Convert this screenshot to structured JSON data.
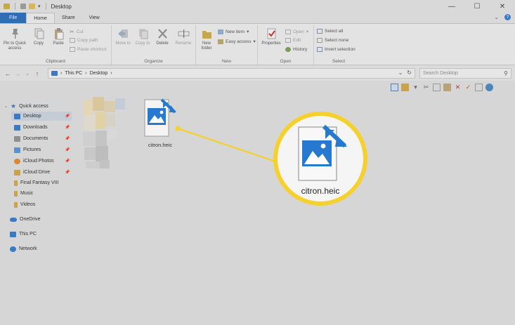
{
  "window": {
    "title": "Desktop"
  },
  "colors": {
    "accent": "#2f6db5",
    "callout": "#f6d02c",
    "heic_blue": "#2779d0"
  },
  "ribbon_tabs": [
    "File",
    "Home",
    "Share",
    "View"
  ],
  "ribbon": {
    "clipboard": {
      "label": "Clipboard",
      "pin": "Pin to Quick access",
      "copy": "Copy",
      "paste": "Paste",
      "cut": "Cut",
      "copy_path": "Copy path",
      "paste_shortcut": "Paste shortcut"
    },
    "organize": {
      "label": "Organize",
      "move_to": "Move to",
      "copy_to": "Copy to",
      "delete": "Delete",
      "rename": "Rename"
    },
    "new": {
      "label": "New",
      "new_folder": "New folder",
      "new_item": "New item",
      "easy_access": "Easy access"
    },
    "open": {
      "label": "Open",
      "properties": "Properties",
      "open": "Open",
      "edit": "Edit",
      "history": "History"
    },
    "select": {
      "label": "Select",
      "select_all": "Select all",
      "select_none": "Select none",
      "invert": "Invert selection"
    }
  },
  "address": {
    "crumbs": [
      "This PC",
      "Desktop"
    ],
    "search_placeholder": "Search Desktop"
  },
  "nav_pane": {
    "quick_access": "Quick access",
    "items": [
      {
        "label": "Desktop",
        "pinned": true,
        "selected": true
      },
      {
        "label": "Downloads",
        "pinned": true
      },
      {
        "label": "Documents",
        "pinned": true
      },
      {
        "label": "Pictures",
        "pinned": true
      },
      {
        "label": "iCloud Photos",
        "pinned": true
      },
      {
        "label": "iCloud Drive",
        "pinned": true
      },
      {
        "label": "Final Fantasy VIII"
      },
      {
        "label": "Music"
      },
      {
        "label": "Videos"
      }
    ],
    "onedrive": "OneDrive",
    "this_pc": "This PC",
    "network": "Network"
  },
  "content": {
    "file_name": "citron.heic",
    "callout_file_name": "citron.heic"
  }
}
